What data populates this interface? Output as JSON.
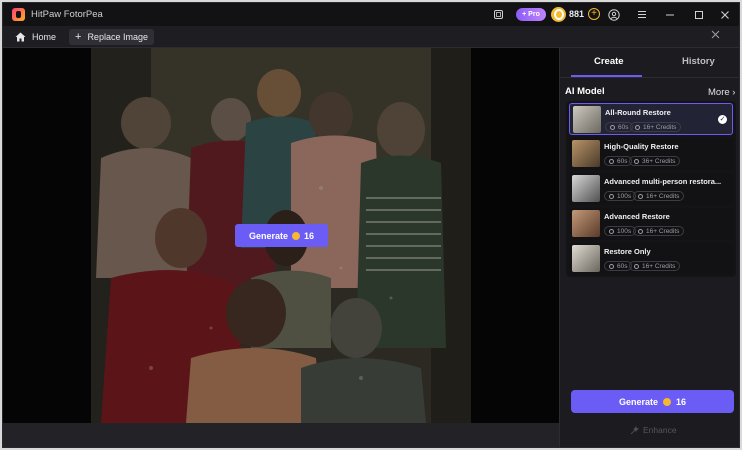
{
  "app": {
    "title": "HitPaw FotorPea"
  },
  "titlebar": {
    "pro_label": "+ Pro",
    "credits": "881",
    "add_symbol": "+",
    "icons": [
      "screen-icon",
      "user-icon",
      "menu-icon",
      "minimize-icon",
      "maximize-icon",
      "close-icon"
    ]
  },
  "toolbar": {
    "home_label": "Home",
    "replace_label": "Replace Image"
  },
  "canvas": {
    "generate_label": "Generate",
    "generate_cost": "16"
  },
  "panel": {
    "tabs": [
      {
        "label": "Create",
        "active": true
      },
      {
        "label": "History",
        "active": false
      }
    ],
    "ai_model_label": "AI Model",
    "more_label": "More",
    "models": [
      {
        "name": "All-Round Restore",
        "time": "60s",
        "credits": "16+ Credits",
        "selected": true
      },
      {
        "name": "High-Quality Restore",
        "time": "60s",
        "credits": "36+ Credits",
        "selected": false
      },
      {
        "name": "Advanced multi-person restora...",
        "time": "100s",
        "credits": "16+ Credits",
        "selected": false
      },
      {
        "name": "Advanced Restore",
        "time": "100s",
        "credits": "16+ Credits",
        "selected": false
      },
      {
        "name": "Restore Only",
        "time": "60s",
        "credits": "16+ Credits",
        "selected": false
      }
    ],
    "generate_label": "Generate",
    "generate_cost": "16",
    "enhance_label": "Enhance"
  },
  "colors": {
    "accent": "#6c5cf6",
    "coin": "#f5b82e",
    "background": "#17171a"
  }
}
